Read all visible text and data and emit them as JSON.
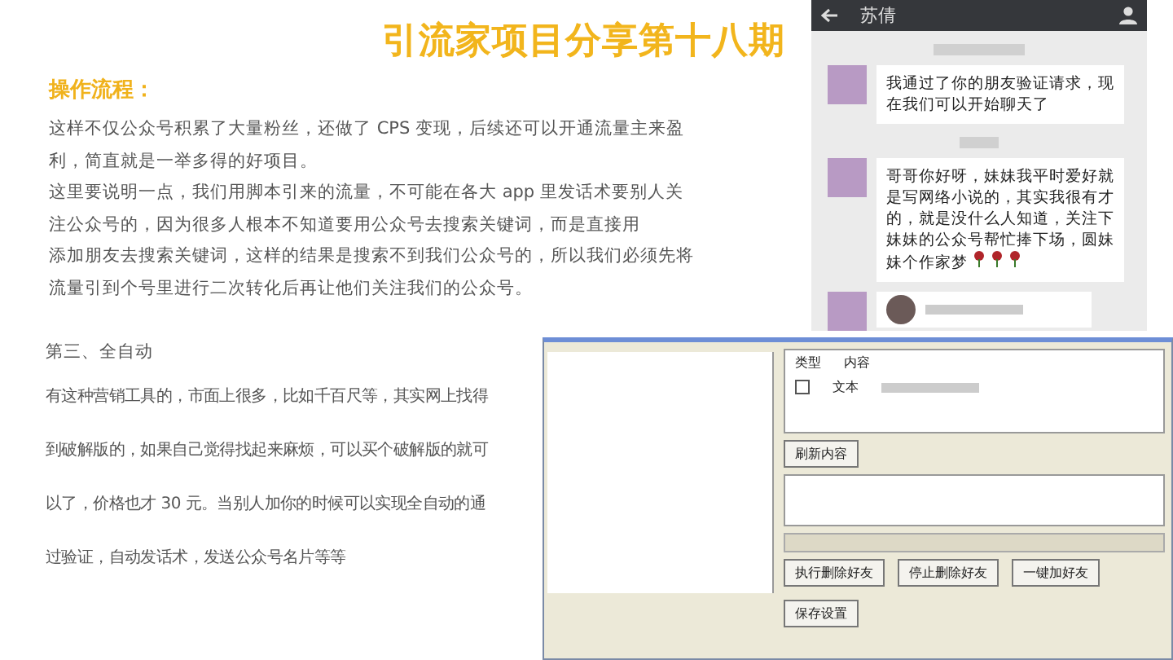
{
  "title": "引流家项目分享第十八期",
  "section_heading": "操作流程：",
  "top_lines": [
    "这样不仅公众号积累了大量粉丝，还做了 CPS 变现，后续还可以开通流量主来盈",
    "利，简直就是一举多得的好项目。",
    "这里要说明一点，我们用脚本引来的流量，不可能在各大 app 里发话术要别人关",
    "注公众号的，因为很多人根本不知道要用公众号去搜索关键词，而是直接用",
    "添加朋友去搜索关键词，这样的结果是搜索不到我们公众号的，所以我们必须先将",
    "流量引到个号里进行二次转化后再让他们关注我们的公众号。"
  ],
  "subheading": "第三、全自动",
  "bottom_lines": [
    "有这种营销工具的，市面上很多，比如千百尺等，其实网上找得",
    "到破解版的，如果自己觉得找起来麻烦，可以买个破解版的就可",
    "以了，价格也才 30 元。当别人加你的时候可以实现全自动的通",
    "过验证，自动发话术，发送公众号名片等等"
  ],
  "chat": {
    "contact": "苏倩",
    "messages": [
      {
        "kind": "text",
        "text": "我通过了你的朋友验证请求，现在我们可以开始聊天了"
      },
      {
        "kind": "text-roses",
        "text": "哥哥你好呀，妹妹我平时爱好就是写网络小说的，其实我很有才的，就是没什么人知道，关注下妹妹的公众号帮忙捧下场，圆妹妹个作家梦"
      },
      {
        "kind": "card"
      }
    ]
  },
  "software": {
    "columns": [
      "类型",
      "内容"
    ],
    "row": {
      "checked": false,
      "type": "文本"
    },
    "buttons": [
      "刷新内容",
      "执行删除好友",
      "停止删除好友",
      "一键加好友",
      "保存设置"
    ]
  }
}
